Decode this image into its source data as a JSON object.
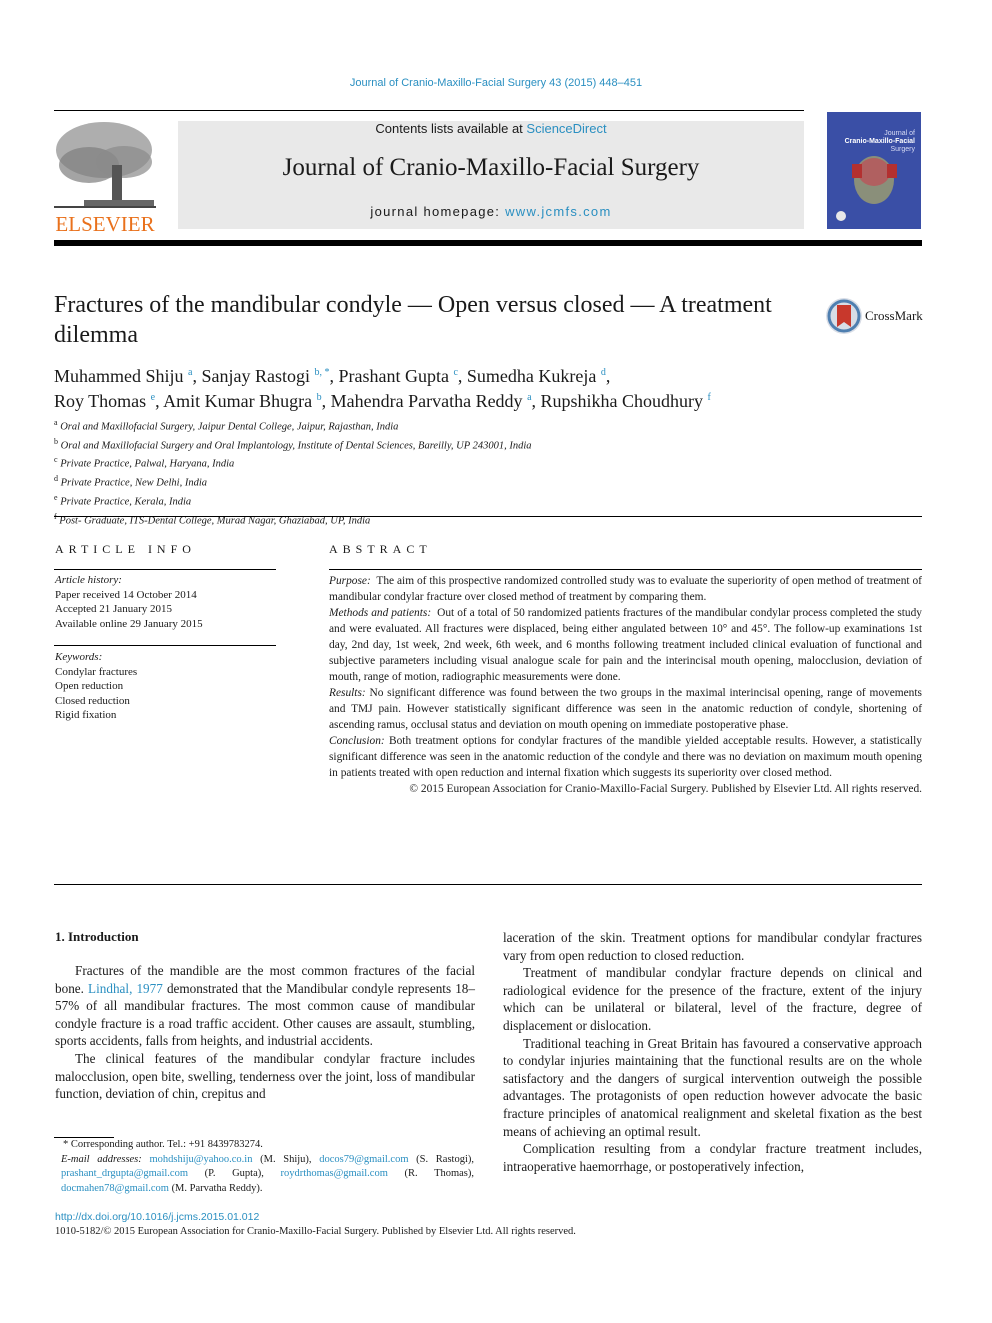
{
  "header": {
    "citation": "Journal of Cranio-Maxillo-Facial Surgery 43 (2015) 448–451",
    "contents_prefix": "Contents lists available at ",
    "contents_link": "ScienceDirect",
    "journal_title": "Journal of Cranio-Maxillo-Facial Surgery",
    "homepage_prefix": "journal homepage: ",
    "homepage_link": "www.jcmfs.com",
    "publisher_logo_text": "ELSEVIER",
    "cover_title_line1": "Journal of",
    "cover_title_line2": "Cranio-Maxillo-Facial",
    "cover_title_line3": "Surgery",
    "crossmark_label": "CrossMark"
  },
  "article": {
    "title": "Fractures of the mandibular condyle — Open versus closed — A treatment dilemma",
    "authors": [
      {
        "name": "Muhammed Shiju",
        "sup": "a"
      },
      {
        "name": "Sanjay Rastogi",
        "sup": "b, *"
      },
      {
        "name": "Prashant Gupta",
        "sup": "c"
      },
      {
        "name": "Sumedha Kukreja",
        "sup": "d"
      },
      {
        "name": "Roy Thomas",
        "sup": "e"
      },
      {
        "name": "Amit Kumar Bhugra",
        "sup": "b"
      },
      {
        "name": "Mahendra Parvatha Reddy",
        "sup": "a"
      },
      {
        "name": "Rupshikha Choudhury",
        "sup": "f"
      }
    ],
    "affiliations": [
      {
        "key": "a",
        "text": "Oral and Maxillofacial Surgery, Jaipur Dental College, Jaipur, Rajasthan, India"
      },
      {
        "key": "b",
        "text": "Oral and Maxillofacial Surgery and Oral Implantology, Institute of Dental Sciences, Bareilly, UP 243001, India"
      },
      {
        "key": "c",
        "text": "Private Practice, Palwal, Haryana, India"
      },
      {
        "key": "d",
        "text": "Private Practice, New Delhi, India"
      },
      {
        "key": "e",
        "text": "Private Practice, Kerala, India"
      },
      {
        "key": "f",
        "text": "Post- Graduate, ITS-Dental College, Murad Nagar, Ghaziabad, UP, India"
      }
    ]
  },
  "article_info": {
    "heading": "ARTICLE INFO",
    "history_label": "Article history:",
    "history": [
      "Paper received 14 October 2014",
      "Accepted 21 January 2015",
      "Available online 29 January 2015"
    ],
    "keywords_label": "Keywords:",
    "keywords": [
      "Condylar fractures",
      "Open reduction",
      "Closed reduction",
      "Rigid fixation"
    ]
  },
  "abstract": {
    "heading": "ABSTRACT",
    "sections": [
      {
        "label": "Purpose:",
        "text": "The aim of this prospective randomized controlled study was to evaluate the superiority of open method of treatment of mandibular condylar fracture over closed method of treatment by comparing them."
      },
      {
        "label": "Methods and patients:",
        "text": "Out of a total of 50 randomized patients fractures of the mandibular condylar process completed the study and were evaluated. All fractures were displaced, being either angulated between 10° and 45°. The follow-up examinations 1st day, 2nd day, 1st week, 2nd week, 6th week, and 6 months following treatment included clinical evaluation of functional and subjective parameters including visual analogue scale for pain and the interincisal mouth opening, malocclusion, deviation of mouth, range of motion, radiographic measurements were done."
      },
      {
        "label": "Results:",
        "text": "No significant difference was found between the two groups in the maximal interincisal opening, range of movements and TMJ pain. However statistically significant difference was seen in the anatomic reduction of condyle, shortening of ascending ramus, occlusal status and deviation on mouth opening on immediate postoperative phase."
      },
      {
        "label": "Conclusion:",
        "text": "Both treatment options for condylar fractures of the mandible yielded acceptable results. However, a statistically significant difference was seen in the anatomic reduction of the condyle and there was no deviation on maximum mouth opening in patients treated with open reduction and internal fixation which suggests its superiority over closed method."
      }
    ],
    "copyright": "© 2015 European Association for Cranio-Maxillo-Facial Surgery. Published by Elsevier Ltd. All rights reserved."
  },
  "body": {
    "section_heading": "1.  Introduction",
    "left_paragraphs": {
      "p1_before": "Fractures of the mandible are the most common fractures of the facial bone. ",
      "p1_link": "Lindhal, 1977",
      "p1_after": " demonstrated that the Mandibular condyle represents 18–57% of all mandibular fractures. The most common cause of mandibular condyle fracture is a road traffic accident. Other causes are assault, stumbling, sports accidents, falls from heights, and industrial accidents.",
      "p2": "The clinical features of the mandibular condylar fracture includes malocclusion, open bite, swelling, tenderness over the joint, loss of mandibular function, deviation of chin, crepitus and"
    },
    "right_paragraphs": [
      "laceration of the skin. Treatment options for mandibular condylar fractures vary from open reduction to closed reduction.",
      "Treatment of mandibular condylar fracture depends on clinical and radiological evidence for the presence of the fracture, extent of the injury which can be unilateral or bilateral, level of the fracture, degree of displacement or dislocation.",
      "Traditional teaching in Great Britain has favoured a conservative approach to condylar injuries maintaining that the functional results are on the whole satisfactory and the dangers of surgical intervention outweigh the possible advantages. The protagonists of open reduction however advocate the basic fracture principles of anatomical realignment and skeletal fixation as the best means of achieving an optimal result.",
      "Complication resulting from a condylar fracture treatment includes, intraoperative haemorrhage, or postoperatively infection,"
    ]
  },
  "footnote": {
    "corresponding": "* Corresponding author. Tel.: +91 8439783274.",
    "email_label": "E-mail addresses:",
    "emails": [
      {
        "email": "mohdshiju@yahoo.co.in",
        "who": "(M. Shiju),"
      },
      {
        "email": "docos79@gmail.com",
        "who": "(S. Rastogi),"
      },
      {
        "email": "prashant_drgupta@gmail.com",
        "who": "(P. Gupta),"
      },
      {
        "email": "roydrthomas@gmail.com",
        "who": "(R. Thomas),"
      },
      {
        "email": "docmahen78@gmail.com",
        "who": "(M. Parvatha Reddy)."
      }
    ]
  },
  "footer": {
    "doi": "http://dx.doi.org/10.1016/j.jcms.2015.01.012",
    "issn": "1010-5182/© 2015 European Association for Cranio-Maxillo-Facial Surgery. Published by Elsevier Ltd. All rights reserved."
  }
}
